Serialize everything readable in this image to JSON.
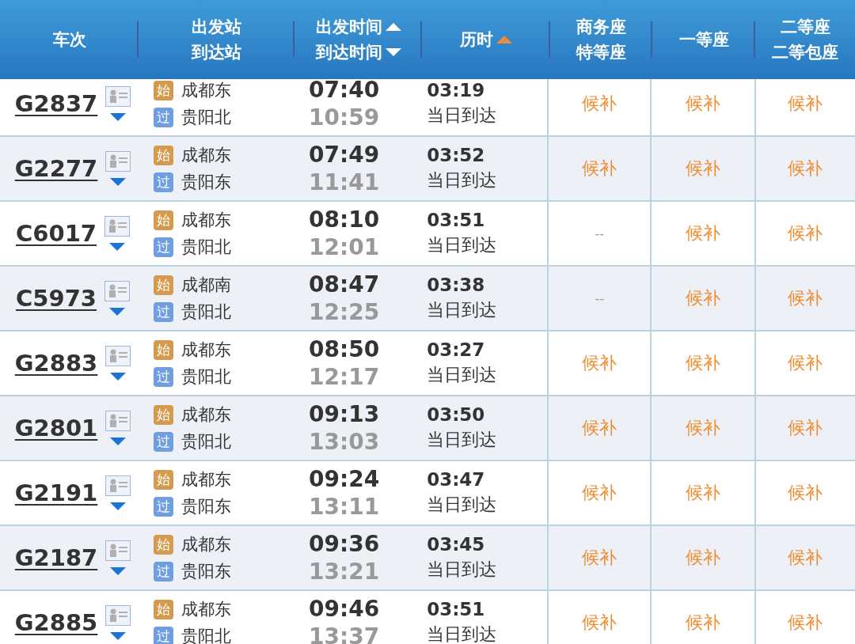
{
  "header": [
    {
      "lines": [
        "车次"
      ],
      "sortable": false,
      "sorted_ascending": false
    },
    {
      "lines": [
        "出发站",
        "到达站"
      ],
      "sortable": false,
      "sorted_ascending": false
    },
    {
      "lines": [
        "出发时间",
        "到达时间"
      ],
      "sortable": true,
      "sorted_ascending": false
    },
    {
      "lines": [
        "历时"
      ],
      "sortable": false,
      "sorted_ascending": true
    },
    {
      "lines": [
        "商务座",
        "特等座"
      ],
      "sortable": false,
      "sorted_ascending": false
    },
    {
      "lines": [
        "一等座"
      ],
      "sortable": false,
      "sorted_ascending": false
    },
    {
      "lines": [
        "二等座",
        "二等包座"
      ],
      "sortable": false,
      "sorted_ascending": false
    }
  ],
  "trains": [
    {
      "number": "G2837",
      "from_badge": "始",
      "from": "成都东",
      "to_badge": "过",
      "to": "贵阳北",
      "depart": "07:40",
      "arrive": "10:59",
      "duration": "03:19",
      "arrival_day": "当日到达",
      "seats": [
        {
          "text": "候补",
          "kind": "waitlist"
        },
        {
          "text": "候补",
          "kind": "waitlist"
        },
        {
          "text": "候补",
          "kind": "waitlist"
        }
      ]
    },
    {
      "number": "G2277",
      "from_badge": "始",
      "from": "成都东",
      "to_badge": "过",
      "to": "贵阳东",
      "depart": "07:49",
      "arrive": "11:41",
      "duration": "03:52",
      "arrival_day": "当日到达",
      "seats": [
        {
          "text": "候补",
          "kind": "waitlist"
        },
        {
          "text": "候补",
          "kind": "waitlist"
        },
        {
          "text": "候补",
          "kind": "waitlist"
        }
      ]
    },
    {
      "number": "C6017",
      "from_badge": "始",
      "from": "成都东",
      "to_badge": "过",
      "to": "贵阳北",
      "depart": "08:10",
      "arrive": "12:01",
      "duration": "03:51",
      "arrival_day": "当日到达",
      "seats": [
        {
          "text": "--",
          "kind": "none"
        },
        {
          "text": "候补",
          "kind": "waitlist"
        },
        {
          "text": "候补",
          "kind": "waitlist"
        }
      ]
    },
    {
      "number": "C5973",
      "from_badge": "始",
      "from": "成都南",
      "to_badge": "过",
      "to": "贵阳北",
      "depart": "08:47",
      "arrive": "12:25",
      "duration": "03:38",
      "arrival_day": "当日到达",
      "seats": [
        {
          "text": "--",
          "kind": "none"
        },
        {
          "text": "候补",
          "kind": "waitlist"
        },
        {
          "text": "候补",
          "kind": "waitlist"
        }
      ]
    },
    {
      "number": "G2883",
      "from_badge": "始",
      "from": "成都东",
      "to_badge": "过",
      "to": "贵阳北",
      "depart": "08:50",
      "arrive": "12:17",
      "duration": "03:27",
      "arrival_day": "当日到达",
      "seats": [
        {
          "text": "候补",
          "kind": "waitlist"
        },
        {
          "text": "候补",
          "kind": "waitlist"
        },
        {
          "text": "候补",
          "kind": "waitlist"
        }
      ]
    },
    {
      "number": "G2801",
      "from_badge": "始",
      "from": "成都东",
      "to_badge": "过",
      "to": "贵阳北",
      "depart": "09:13",
      "arrive": "13:03",
      "duration": "03:50",
      "arrival_day": "当日到达",
      "seats": [
        {
          "text": "候补",
          "kind": "waitlist"
        },
        {
          "text": "候补",
          "kind": "waitlist"
        },
        {
          "text": "候补",
          "kind": "waitlist"
        }
      ]
    },
    {
      "number": "G2191",
      "from_badge": "始",
      "from": "成都东",
      "to_badge": "过",
      "to": "贵阳东",
      "depart": "09:24",
      "arrive": "13:11",
      "duration": "03:47",
      "arrival_day": "当日到达",
      "seats": [
        {
          "text": "候补",
          "kind": "waitlist"
        },
        {
          "text": "候补",
          "kind": "waitlist"
        },
        {
          "text": "候补",
          "kind": "waitlist"
        }
      ]
    },
    {
      "number": "G2187",
      "from_badge": "始",
      "from": "成都东",
      "to_badge": "过",
      "to": "贵阳东",
      "depart": "09:36",
      "arrive": "13:21",
      "duration": "03:45",
      "arrival_day": "当日到达",
      "seats": [
        {
          "text": "候补",
          "kind": "waitlist"
        },
        {
          "text": "候补",
          "kind": "waitlist"
        },
        {
          "text": "候补",
          "kind": "waitlist"
        }
      ]
    },
    {
      "number": "G2885",
      "from_badge": "始",
      "from": "成都东",
      "to_badge": "过",
      "to": "贵阳北",
      "depart": "09:46",
      "arrive": "13:37",
      "duration": "03:51",
      "arrival_day": "当日到达",
      "seats": [
        {
          "text": "候补",
          "kind": "waitlist"
        },
        {
          "text": "候补",
          "kind": "waitlist"
        },
        {
          "text": "候补",
          "kind": "waitlist"
        }
      ]
    }
  ]
}
